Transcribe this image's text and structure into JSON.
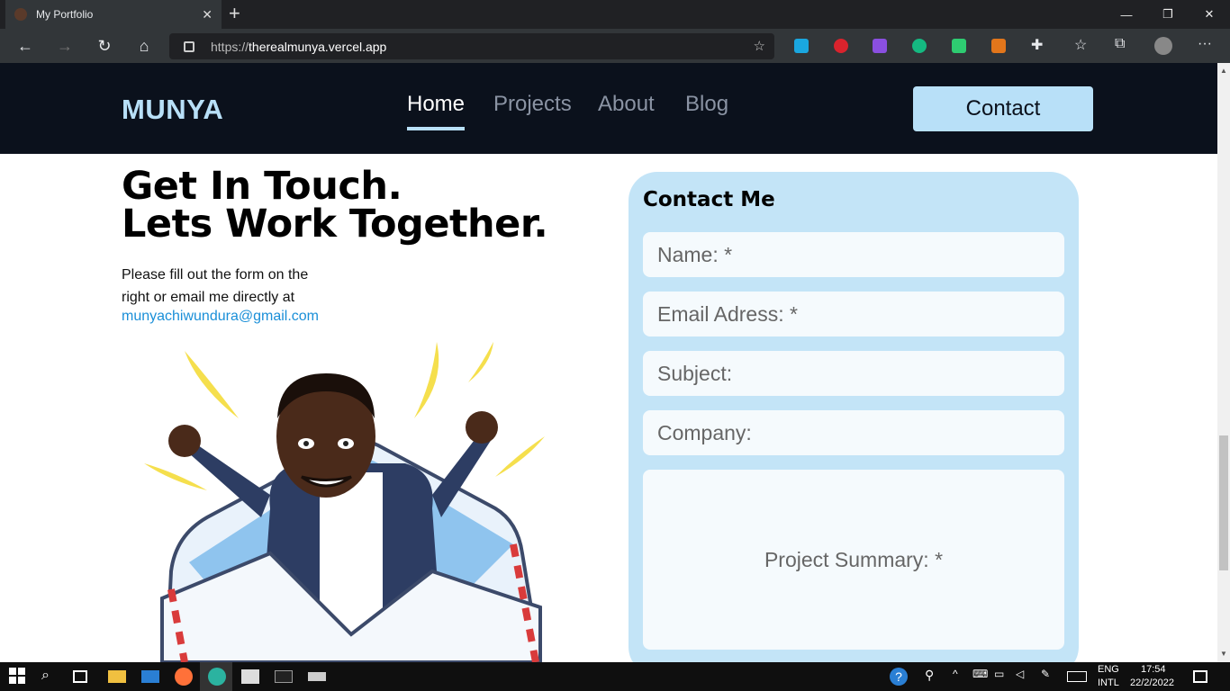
{
  "browser": {
    "tab_title": "My Portfolio",
    "url_scheme": "https://",
    "url_host": "therealmunya.vercel.app"
  },
  "site": {
    "logo": "MUNYA",
    "nav": [
      "Home",
      "Projects",
      "About",
      "Blog"
    ],
    "active_nav": "Home",
    "contact_button": "Contact"
  },
  "hero": {
    "headline_1": "Get In Touch.",
    "headline_2": "Lets Work Together.",
    "intro_1": "Please fill out the form on the",
    "intro_2": "right or email me directly at",
    "email": "munyachiwundura@gmail.com"
  },
  "form": {
    "title": "Contact Me",
    "name_placeholder": "Name: *",
    "email_placeholder": "Email Adress: *",
    "subject_placeholder": "Subject:",
    "company_placeholder": "Company:",
    "summary_placeholder": "Project Summary: *"
  },
  "taskbar": {
    "lang_1": "ENG",
    "lang_2": "INTL",
    "time": "17:54",
    "date": "22/2/2022"
  },
  "colors": {
    "accent": "#b8e0f8",
    "nav_bg": "#0b111c",
    "form_bg": "#c3e4f7",
    "link": "#1a8fd8"
  }
}
